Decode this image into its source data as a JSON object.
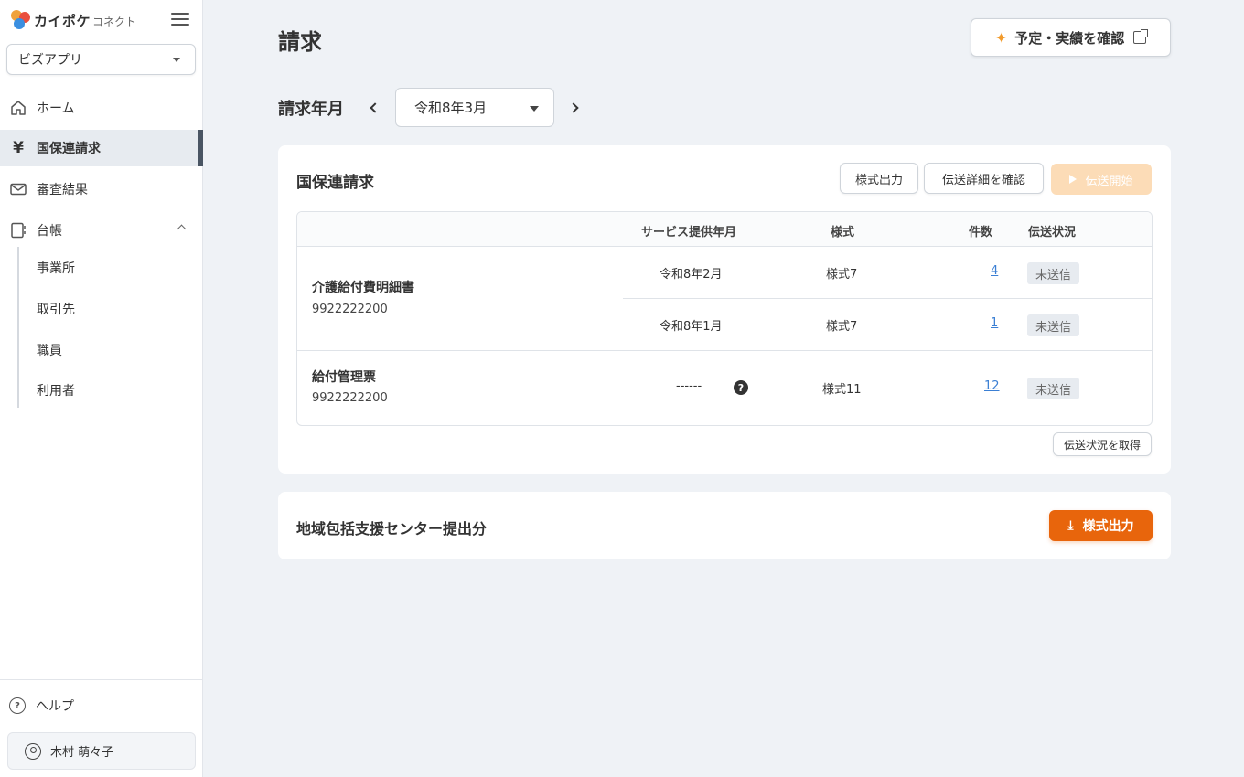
{
  "app": {
    "logo_text": "カイポケ",
    "logo_sub": "コネクト",
    "app_select": "ビズアプリ"
  },
  "sidebar": {
    "items": [
      {
        "label": "ホーム",
        "icon": "home-icon"
      },
      {
        "label": "国保連請求",
        "icon": "yen-icon",
        "active": true
      },
      {
        "label": "審査結果",
        "icon": "mail-icon"
      },
      {
        "label": "台帳",
        "icon": "ledger-icon",
        "expanded": true
      }
    ],
    "sub_items": [
      "事業所",
      "取引先",
      "職員",
      "利用者"
    ],
    "help": "ヘルプ",
    "user": "木村 萌々子"
  },
  "page": {
    "title": "請求",
    "top_button": "予定・実績を確認",
    "period_label": "請求年月",
    "period_value": "令和8年3月"
  },
  "kokuho": {
    "title": "国保連請求",
    "buttons": {
      "export": "様式出力",
      "details": "伝送詳細を確認",
      "start": "伝送開始"
    },
    "headers": {
      "service_month": "サービス提供年月",
      "form": "様式",
      "count": "件数",
      "status": "伝送状況"
    },
    "groups": [
      {
        "name": "介護給付費明細書",
        "code": "9922222200",
        "rows": [
          {
            "month": "令和8年2月",
            "form": "様式7",
            "count": "4",
            "status": "未送信"
          },
          {
            "month": "令和8年1月",
            "form": "様式7",
            "count": "1",
            "status": "未送信"
          }
        ]
      },
      {
        "name": "給付管理票",
        "code": "9922222200",
        "rows": [
          {
            "month": "------",
            "form": "様式11",
            "count": "12",
            "status": "未送信"
          }
        ]
      }
    ],
    "fetch_status_button": "伝送状況を取得"
  },
  "chiiki": {
    "title": "地域包括支援センター提出分",
    "export_button": "様式出力"
  },
  "colors": {
    "accent": "#e8650c",
    "accent_disabled": "#fcdcb7",
    "link": "#3b7fd4",
    "background": "#eff2f6"
  }
}
